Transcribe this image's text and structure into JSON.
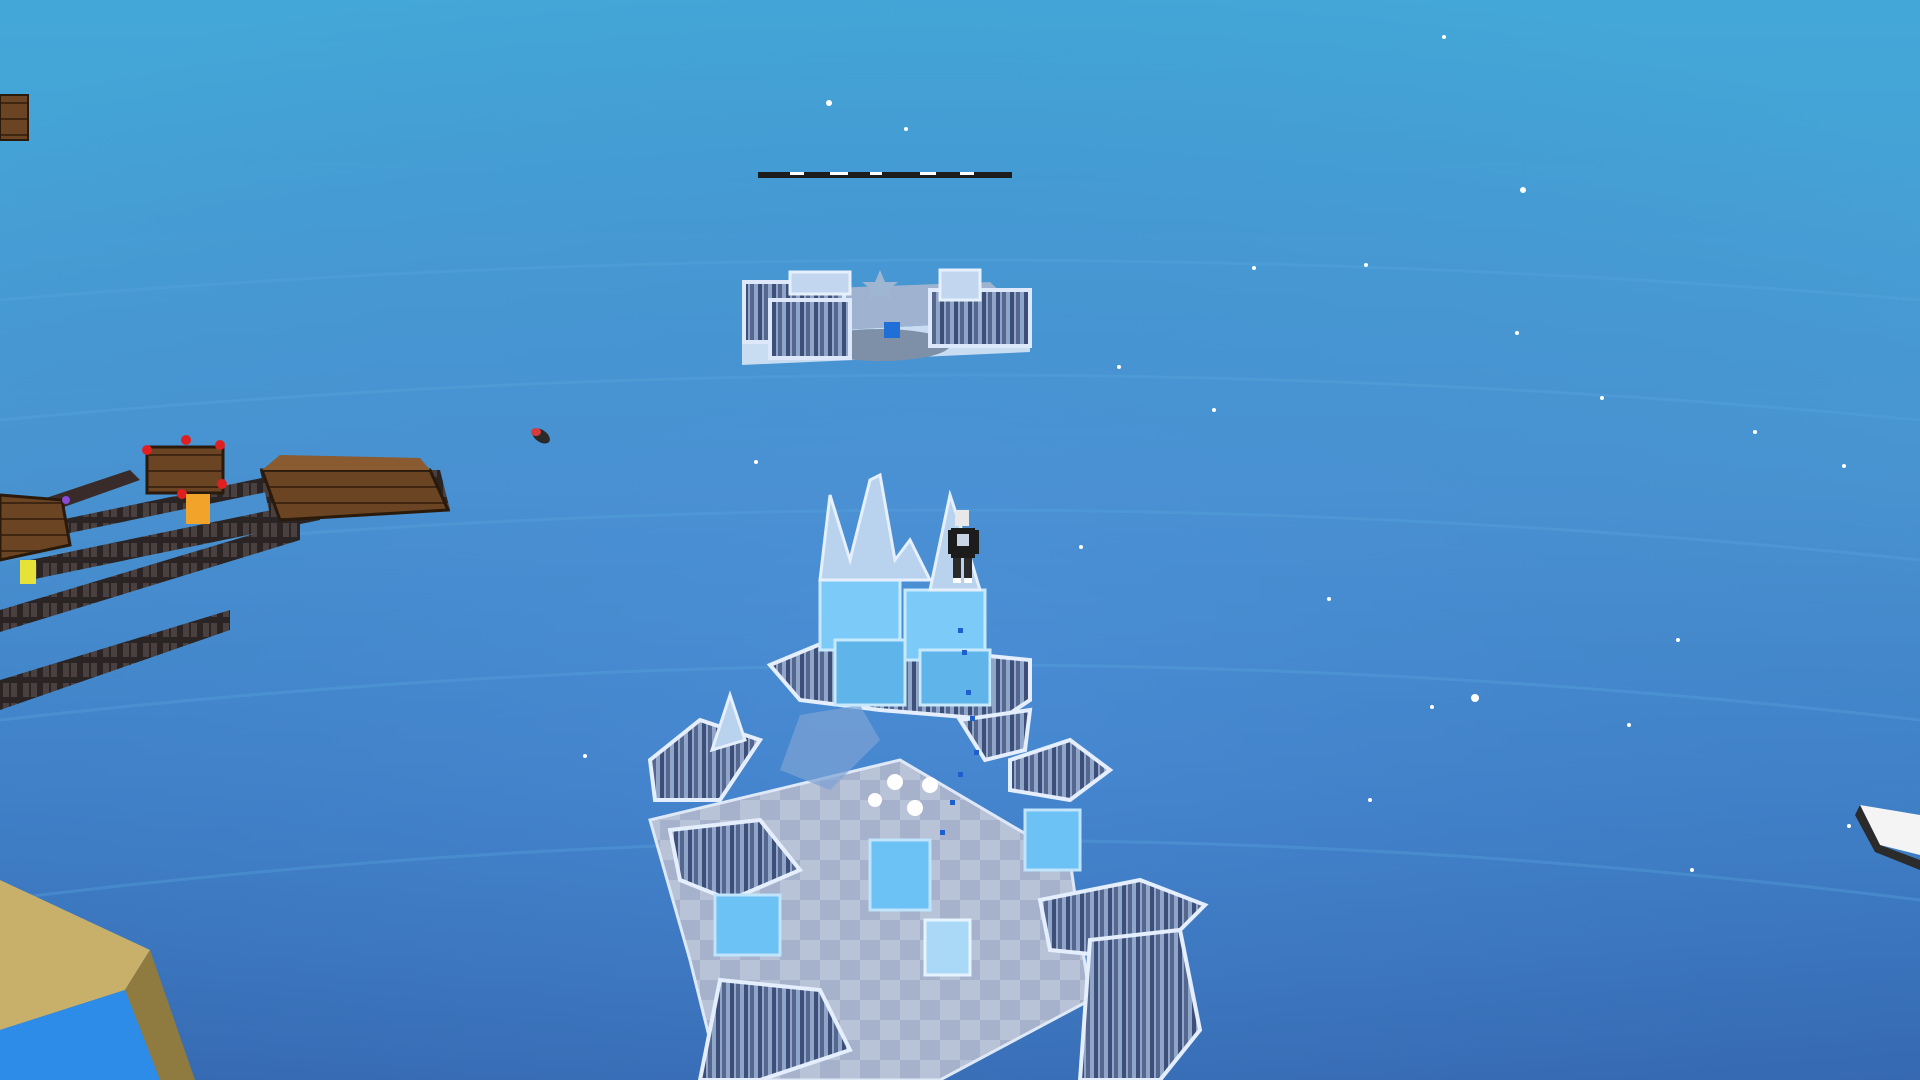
{
  "game": {
    "scene": "sky-obby",
    "sky_top_color": "#43a6d6",
    "sky_mid_color": "#4a8fcf",
    "sky_bottom_color": "#3a6fb0",
    "ice_color": "#a9d9f7",
    "ice_dark_color": "#5fb4ea",
    "wood_color": "#6b4423",
    "metal_color": "#2f2a2a",
    "sand_color": "#c9b06a",
    "water_color": "#2d8ce8",
    "player_shirt_color": "#1c1c1c"
  }
}
